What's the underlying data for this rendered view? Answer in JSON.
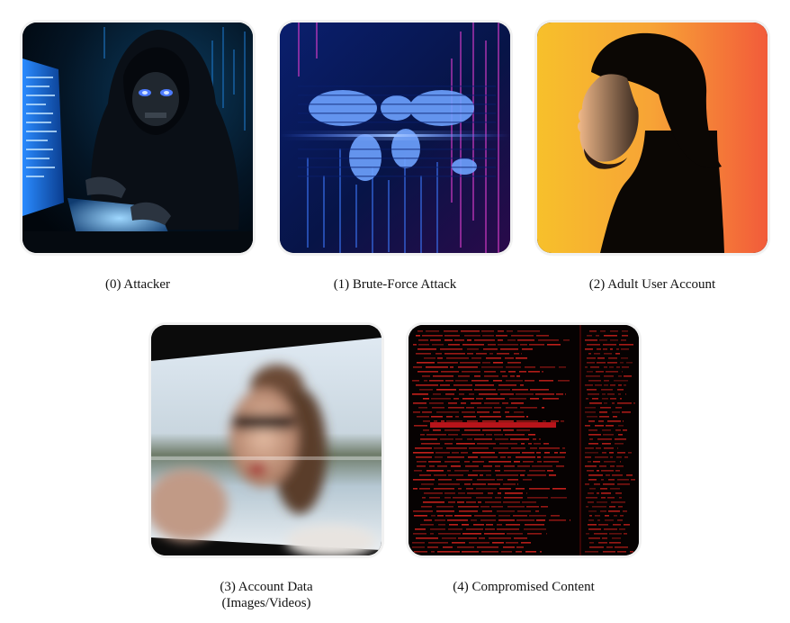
{
  "panels": [
    {
      "caption": "(0) Attacker",
      "image": "hooded-hacker-at-keyboard"
    },
    {
      "caption": "(1) Brute-Force Attack",
      "image": "digital-world-map-matrix"
    },
    {
      "caption": "(2) Adult User Account",
      "image": "profile-silhouette-orange"
    },
    {
      "caption": "(3) Account Data\n(Images/Videos)",
      "image": "blurred-woman-sunglasses"
    },
    {
      "caption": "(4) Compromised Content",
      "image": "red-code-terminal"
    }
  ],
  "colors": {
    "hacker_glow": "#1e90ff",
    "matrix_blue": "#1a3aa8",
    "matrix_pink": "#c2189b",
    "profile_yellow": "#f7c02b",
    "profile_red": "#f25b3a",
    "code_red": "#e0201c"
  }
}
